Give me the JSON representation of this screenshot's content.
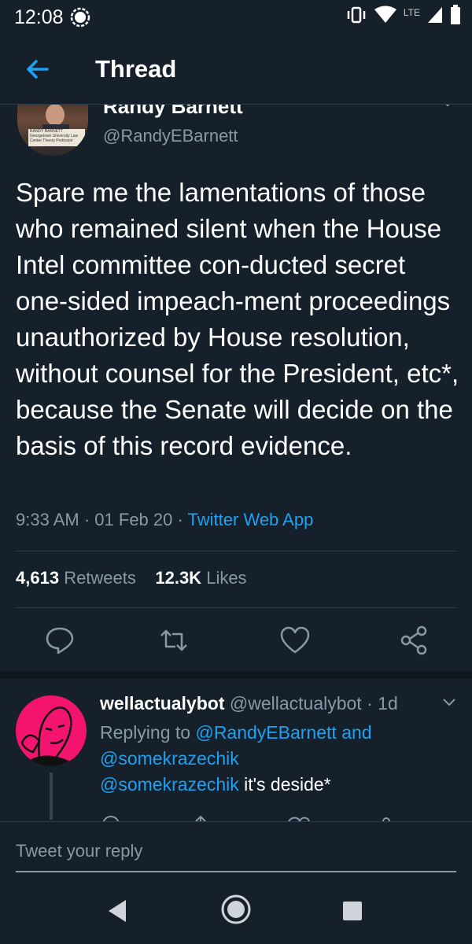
{
  "status_bar": {
    "time": "12:08",
    "network": "LTE"
  },
  "header": {
    "title": "Thread"
  },
  "tweet": {
    "author_name": "Randy Barnett",
    "author_handle": "@RandyEBarnett",
    "avatar_caption": "RANDY BARNETT Georgetown University Law Center Theory Professor",
    "text": "Spare me the lamentations of those who remained silent when the House Intel committee con-ducted secret one-sided impeach-ment proceedings unauthorized by House resolution, without counsel for the President, etc*, because the Senate will decide on the basis of this record evidence.",
    "time": "9:33 AM",
    "date": "01 Feb 20",
    "source": "Twitter Web App",
    "retweets_count": "4,613",
    "retweets_label": "Retweets",
    "likes_count": "12.3K",
    "likes_label": "Likes"
  },
  "reply": {
    "name": "wellactualybot",
    "handle": "@wellactualybot",
    "age": "1d",
    "replying_prefix": "Replying to",
    "mention1": "@RandyEBarnett",
    "and_text": "and",
    "mention2": "@somekrazechik",
    "body_mention": "@somekrazechik",
    "body_text": " it's deside*"
  },
  "compose": {
    "placeholder": "Tweet your reply"
  },
  "colors": {
    "background": "#15202b",
    "accent": "#1da1f2",
    "muted": "#8899a6",
    "reply_avatar": "#f2146e"
  }
}
